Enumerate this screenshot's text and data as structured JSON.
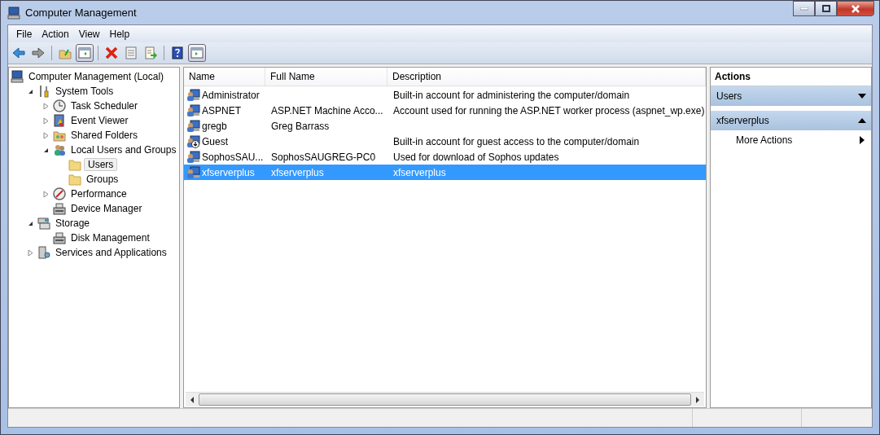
{
  "window": {
    "title": "Computer Management"
  },
  "menu": [
    "File",
    "Action",
    "View",
    "Help"
  ],
  "toolbar": [
    {
      "kind": "back",
      "pressed": false
    },
    {
      "kind": "forward",
      "pressed": false
    },
    {
      "kind": "sep"
    },
    {
      "kind": "up",
      "pressed": false
    },
    {
      "kind": "pane",
      "pressed": true
    },
    {
      "kind": "sep"
    },
    {
      "kind": "delete",
      "pressed": false
    },
    {
      "kind": "properties",
      "pressed": false
    },
    {
      "kind": "export",
      "pressed": false
    },
    {
      "kind": "sep"
    },
    {
      "kind": "help",
      "pressed": false
    },
    {
      "kind": "pane2",
      "pressed": true
    }
  ],
  "tree": [
    {
      "label": "Computer Management (Local)",
      "selected": false,
      "children": [
        {
          "label": "System Tools",
          "expanded": true,
          "selected": false,
          "children": [
            {
              "label": "Task Scheduler",
              "expanded": false,
              "selected": false
            },
            {
              "label": "Event Viewer",
              "expanded": false,
              "selected": false
            },
            {
              "label": "Shared Folders",
              "expanded": false,
              "selected": false
            },
            {
              "label": "Local Users and Groups",
              "expanded": true,
              "selected": false,
              "children": [
                {
                  "label": "Users",
                  "selected": true
                },
                {
                  "label": "Groups",
                  "selected": false
                }
              ]
            },
            {
              "label": "Performance",
              "expanded": false,
              "selected": false
            },
            {
              "label": "Device Manager",
              "selected": false
            }
          ]
        },
        {
          "label": "Storage",
          "expanded": true,
          "selected": false,
          "children": [
            {
              "label": "Disk Management",
              "selected": false
            }
          ]
        },
        {
          "label": "Services and Applications",
          "expanded": false,
          "selected": false
        }
      ]
    }
  ],
  "table": {
    "columns": [
      "Name",
      "Full Name",
      "Description"
    ],
    "rows": [
      {
        "name": "Administrator",
        "full_name": "",
        "description": "Built-in account for administering the computer/domain",
        "disabled": false,
        "selected": false
      },
      {
        "name": "ASPNET",
        "full_name": "ASP.NET Machine Acco...",
        "description": "Account used for running the ASP.NET worker process (aspnet_wp.exe)",
        "disabled": false,
        "selected": false
      },
      {
        "name": "gregb",
        "full_name": "Greg Barrass",
        "description": "",
        "disabled": false,
        "selected": false
      },
      {
        "name": "Guest",
        "full_name": "",
        "description": "Built-in account for guest access to the computer/domain",
        "disabled": true,
        "selected": false
      },
      {
        "name": "SophosSAU...",
        "full_name": "SophosSAUGREG-PC0",
        "description": "Used for download of Sophos updates",
        "disabled": false,
        "selected": false
      },
      {
        "name": "xfserverplus",
        "full_name": "xfserverplus",
        "description": "xfserverplus",
        "disabled": false,
        "selected": true
      }
    ]
  },
  "actions": {
    "title": "Actions",
    "sections": [
      {
        "title": "Users",
        "expanded": false
      },
      {
        "title": "xfserverplus",
        "expanded": true,
        "items": [
          {
            "label": "More Actions",
            "submenu": true
          }
        ]
      }
    ]
  }
}
